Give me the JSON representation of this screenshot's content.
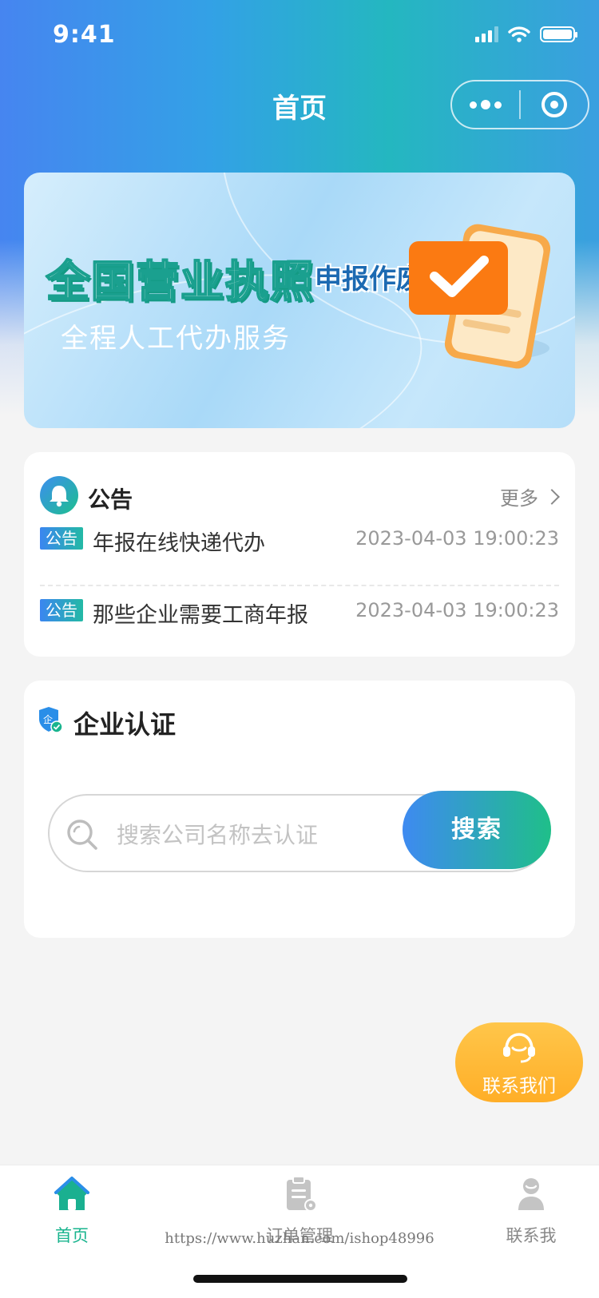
{
  "status_bar": {
    "time": "9:41"
  },
  "nav": {
    "title": "首页"
  },
  "banner": {
    "title": "全国营业执照",
    "title_suffix": "申报作废",
    "subtitle": "全程人工代办服务"
  },
  "notice": {
    "title": "公告",
    "more_label": "更多",
    "items": [
      {
        "tag": "公告",
        "text": "年报在线快递代办",
        "time": "2023-04-03 19:00:23"
      },
      {
        "tag": "公告",
        "text": "那些企业需要工商年报",
        "time": "2023-04-03 19:00:23"
      }
    ]
  },
  "certification": {
    "title": "企业认证",
    "search_placeholder": "搜索公司名称去认证",
    "search_button": "搜索"
  },
  "contact_button": {
    "label": "联系我们"
  },
  "tabbar": {
    "items": [
      {
        "label": "首页",
        "icon": "home-icon",
        "active": true
      },
      {
        "label": "订单管理",
        "icon": "clipboard-icon",
        "active": false
      },
      {
        "label": "联系我",
        "icon": "user-icon",
        "active": false
      }
    ]
  },
  "watermark": "https://www.huzhan.com/ishop48996",
  "colors": {
    "accent_blue": "#3e8af1",
    "accent_green": "#1fbf89",
    "contact_orange": "#ffae27",
    "active_tab": "#19b48e"
  }
}
